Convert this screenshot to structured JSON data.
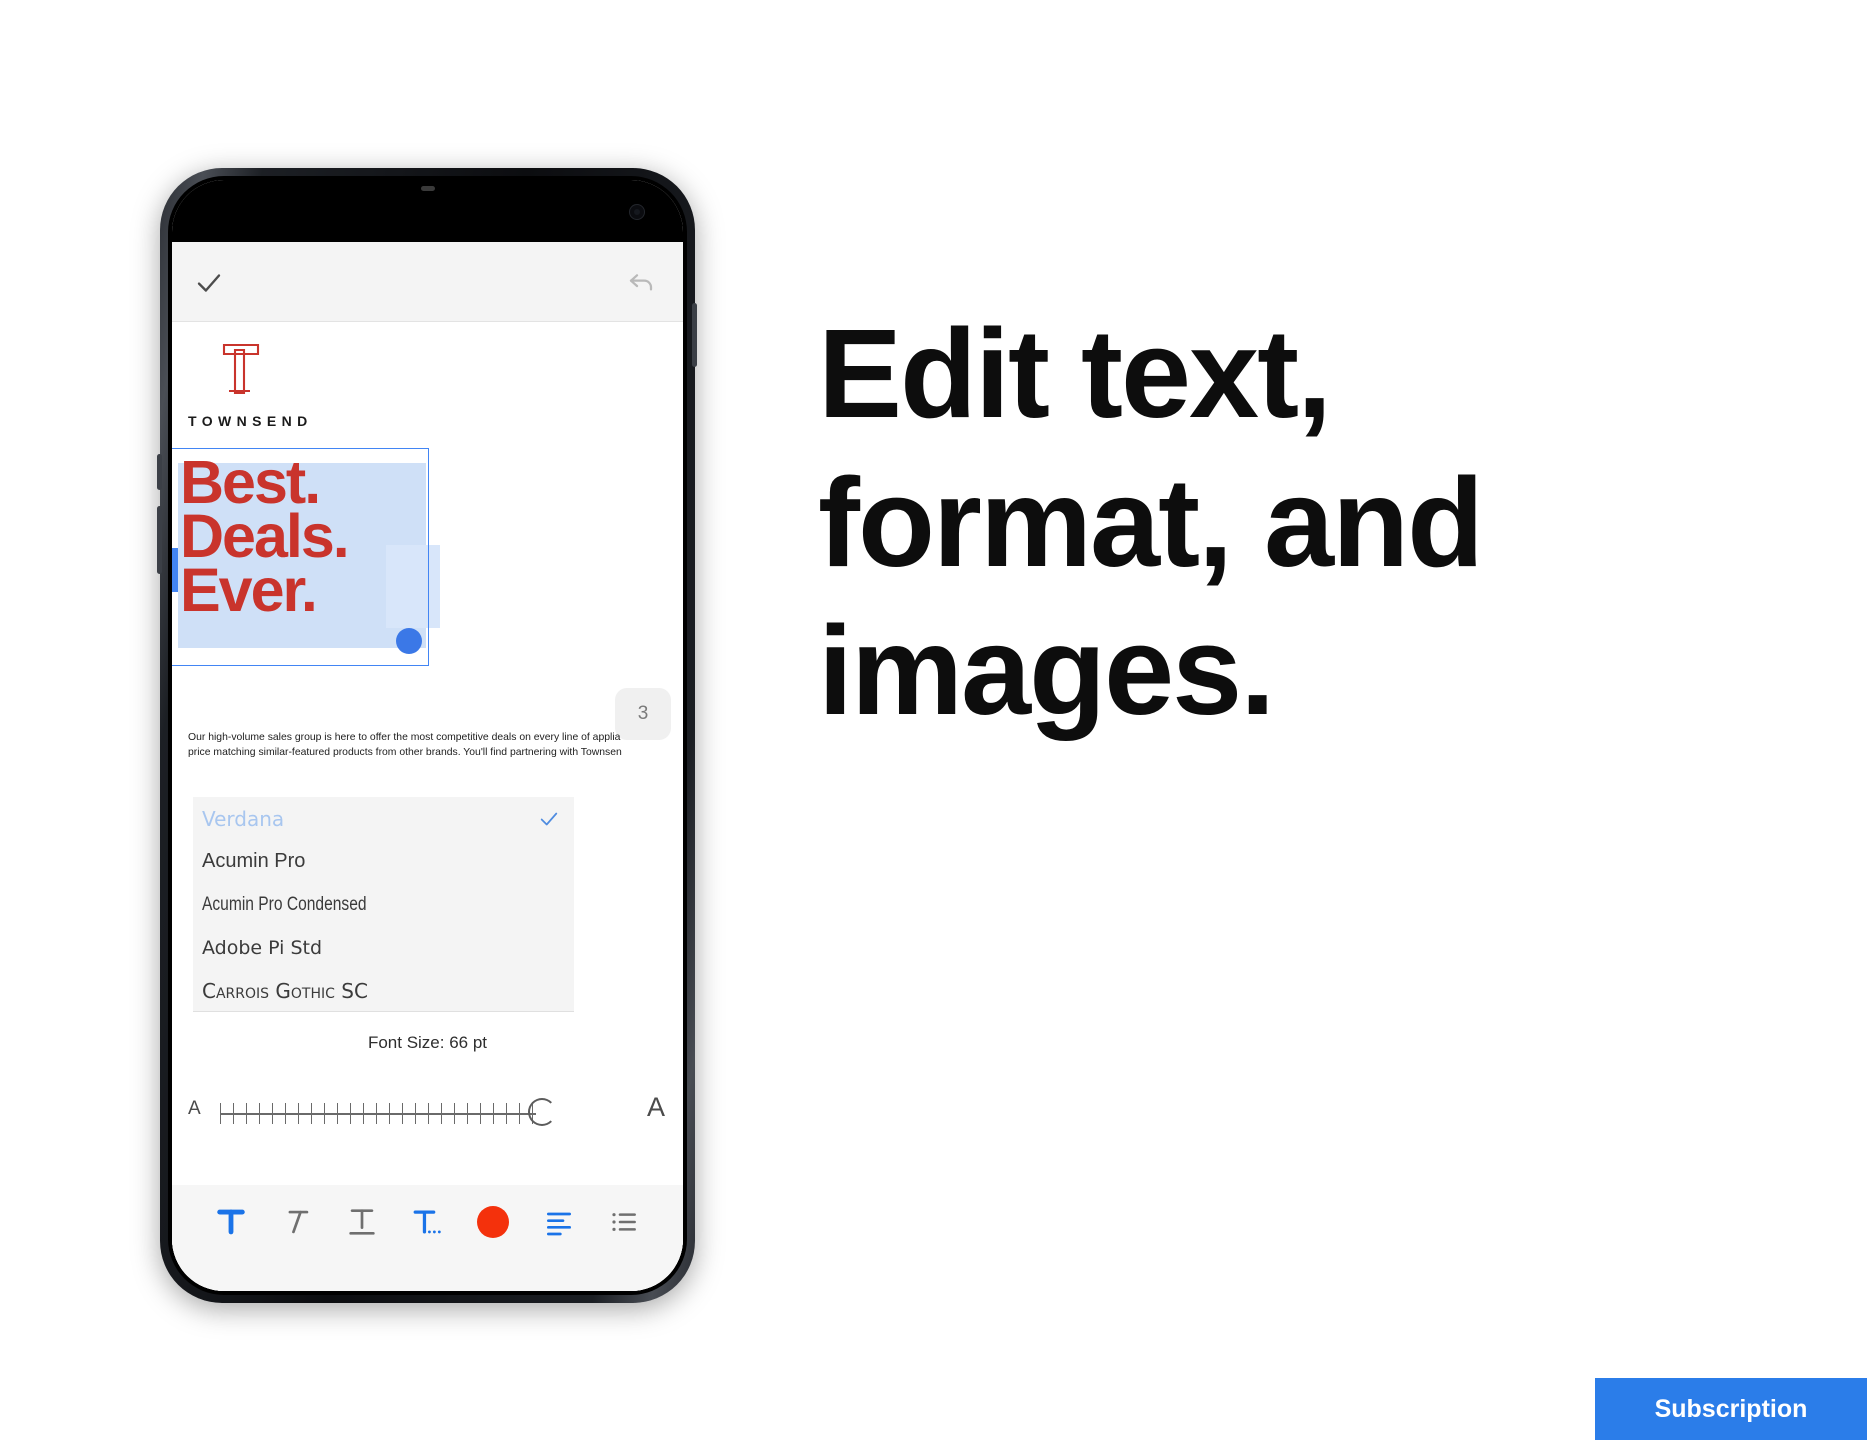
{
  "app": {
    "topbar": {
      "confirm_icon": "check-icon",
      "undo_icon": "undo-icon"
    },
    "document": {
      "logo_icon": "townsend-t-logo-icon",
      "brand_name": "TOWNSEND",
      "headline": "Best.\nDeals.\nEver.",
      "headline_color": "#c9342c",
      "selection_accent": "#4285f4",
      "page_number": "3",
      "body_copy": "Our high-volume sales group is here to offer the most competitive deals on every line of applia price matching similar-featured products from other brands. You'll find partnering with Townsen"
    },
    "font_panel": {
      "fonts": [
        {
          "name": "Verdana",
          "selected": true
        },
        {
          "name": "Acumin Pro",
          "selected": false
        },
        {
          "name": "Acumin Pro Condensed",
          "selected": false
        },
        {
          "name": "Adobe Pi Std",
          "selected": false
        },
        {
          "name": "Carrois Gothic SC",
          "selected": false
        }
      ],
      "check_icon": "check-icon",
      "font_size_label": "Font Size: 66 pt",
      "font_size_value": 66,
      "slider_min_label": "A",
      "slider_max_label": "A",
      "slider_position_pct": 97
    },
    "toolbar": {
      "items": [
        {
          "icon": "bold-text-icon",
          "label": "T",
          "active": true
        },
        {
          "icon": "italic-text-icon",
          "label": "T",
          "active": false
        },
        {
          "icon": "underline-text-icon",
          "label": "T",
          "active": false
        },
        {
          "icon": "more-text-options-icon",
          "label": "T…",
          "active": true
        },
        {
          "icon": "text-color-icon",
          "label": "",
          "active": true
        },
        {
          "icon": "align-left-icon",
          "label": "",
          "active": true
        },
        {
          "icon": "bulleted-list-icon",
          "label": "",
          "active": false
        }
      ],
      "active_color": "#1a73e8",
      "inactive_color": "#6f6f6f",
      "selected_text_color": "#f4310c"
    }
  },
  "promo": {
    "headline_line1": "Edit text,",
    "headline_line2": "format, and",
    "headline_line3": "images."
  },
  "cta": {
    "label": "Subscription",
    "color": "#2b7de9"
  }
}
